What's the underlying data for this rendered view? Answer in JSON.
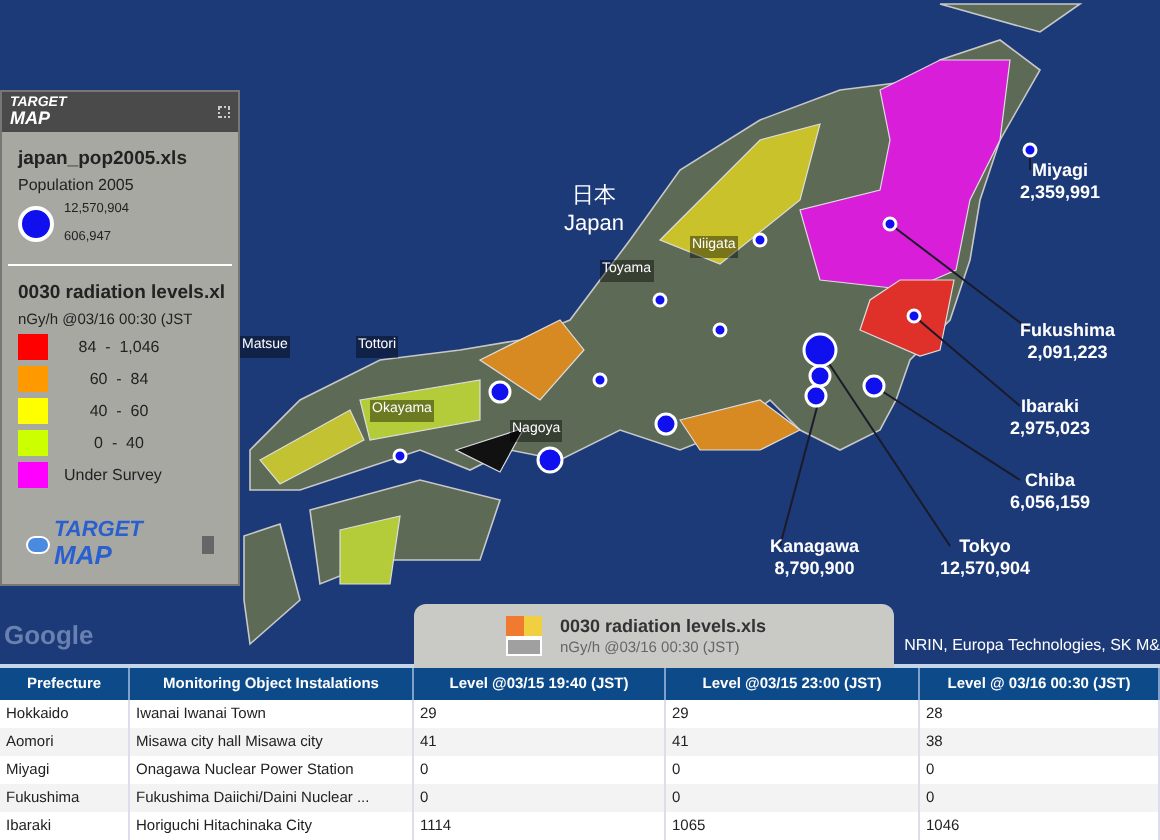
{
  "map": {
    "country_label": "日本",
    "country_label_en": "Japan",
    "place_labels": [
      "Matsue",
      "Tottori",
      "Okayama",
      "Nagoya",
      "Niigata",
      "Toyama"
    ],
    "callouts": [
      {
        "name": "Miyagi",
        "value": "2,359,991"
      },
      {
        "name": "Fukushima",
        "value": "2,091,223"
      },
      {
        "name": "Ibaraki",
        "value": "2,975,023"
      },
      {
        "name": "Chiba",
        "value": "6,056,159"
      },
      {
        "name": "Kanagawa",
        "value": "8,790,900"
      },
      {
        "name": "Tokyo",
        "value": "12,570,904"
      }
    ],
    "google_logo": "Google",
    "copyright": "NRIN, Europa Technologies, SK M&"
  },
  "legend": {
    "header_logo": [
      "TARGET",
      "MAP"
    ],
    "dataset1": {
      "title": "japan_pop2005.xls",
      "subtitle": "Population 2005",
      "max": "12,570,904",
      "min": "606,947"
    },
    "dataset2": {
      "title": "0030 radiation levels.xl",
      "subtitle": "nGy/h @03/16 00:30 (JST",
      "ranges": [
        {
          "range": "84  -  1,046",
          "color": "#ff0000"
        },
        {
          "range": "60  -  84",
          "color": "#ff9900"
        },
        {
          "range": "40  -  60",
          "color": "#ffff00"
        },
        {
          "range": "0  -  40",
          "color": "#ccff00"
        },
        {
          "label": "Under Survey",
          "color": "#ff00ff"
        }
      ]
    },
    "footer_logo": [
      "TARGET",
      "MAP"
    ]
  },
  "popup": {
    "title": "0030 radiation levels.xls",
    "subtitle": "nGy/h @03/16 00:30 (JST)"
  },
  "table": {
    "columns": [
      "Prefecture",
      "Monitoring Object Instalations",
      "Level @03/15 19:40 (JST)",
      "Level @03/15  23:00 (JST)",
      "Level @ 03/16 00:30 (JST)"
    ],
    "rows": [
      [
        "Hokkaido",
        "Iwanai Iwanai Town",
        "29",
        "29",
        "28"
      ],
      [
        "Aomori",
        "Misawa city hall Misawa city",
        "41",
        "41",
        "38"
      ],
      [
        "Miyagi",
        "Onagawa Nuclear Power Station",
        "0",
        "0",
        "0"
      ],
      [
        "Fukushima",
        "Fukushima Daiichi/Daini Nuclear ...",
        "0",
        "0",
        "0"
      ],
      [
        "Ibaraki",
        "Horiguchi Hitachinaka City",
        "1114",
        "1065",
        "1046"
      ]
    ]
  }
}
